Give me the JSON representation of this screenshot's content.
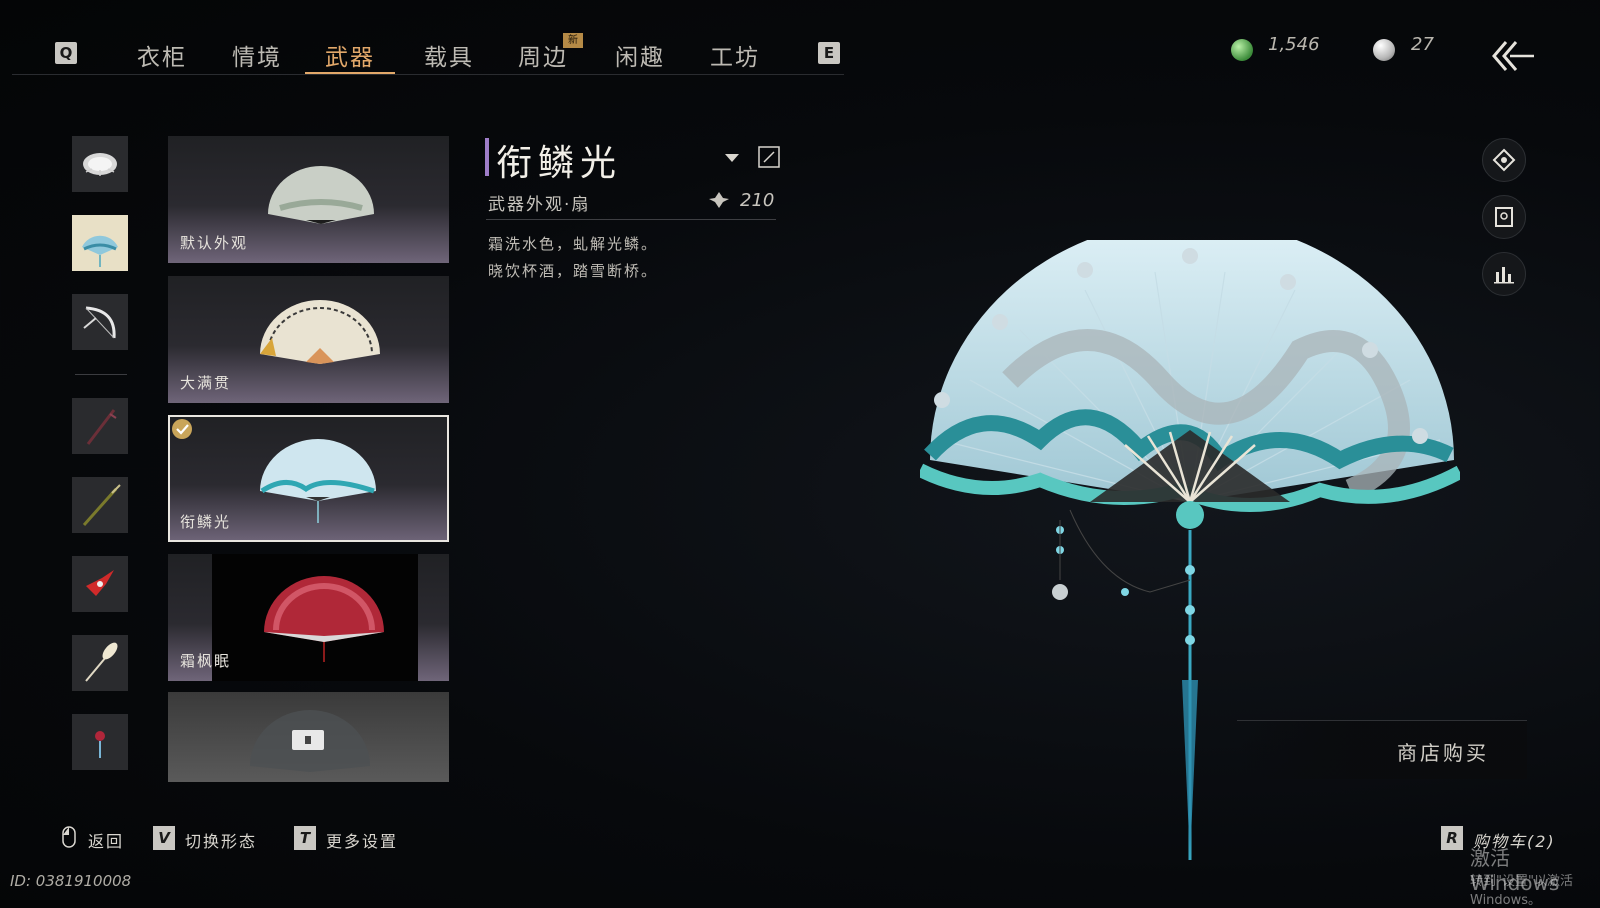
{
  "nav": {
    "prev_key": "Q",
    "next_key": "E",
    "tabs": [
      {
        "label": "衣柜"
      },
      {
        "label": "情境"
      },
      {
        "label": "武器",
        "active": true
      },
      {
        "label": "载具"
      },
      {
        "label": "周边",
        "badge": "新"
      },
      {
        "label": "闲趣"
      },
      {
        "label": "工坊"
      }
    ]
  },
  "currency": {
    "jade": {
      "icon": "jade-coin-icon",
      "value": "1,546"
    },
    "pearl": {
      "icon": "pearl-icon",
      "value": "27"
    }
  },
  "categories": [
    {
      "icon": "umbrella-icon"
    },
    {
      "icon": "fan-icon",
      "selected": true
    },
    {
      "icon": "bow-icon"
    },
    {
      "icon": "staff-icon"
    },
    {
      "icon": "spear-icon"
    },
    {
      "icon": "red-blade-icon"
    },
    {
      "icon": "brush-icon"
    },
    {
      "icon": "tassel-icon"
    }
  ],
  "items": [
    {
      "name": "默认外观"
    },
    {
      "name": "大满贯"
    },
    {
      "name": "衔鳞光",
      "selected": true,
      "owned": true
    },
    {
      "name": "霜枫眠"
    },
    {
      "name": "",
      "locked": true
    }
  ],
  "detail": {
    "title": "衔鳞光",
    "type": "武器外观·扇",
    "score": "210",
    "desc_line1": "霜洗水色，虬解光鳞。",
    "desc_line2": "晓饮杯酒，踏雪断桥。"
  },
  "side_buttons": [
    {
      "icon": "compass-icon"
    },
    {
      "icon": "frame-icon"
    },
    {
      "icon": "bar-chart-icon"
    }
  ],
  "shop_button": "商店购买",
  "footer": {
    "back_label": "返回",
    "switch_key": "V",
    "switch_label": "切换形态",
    "settings_key": "T",
    "settings_label": "更多设置",
    "cart_key": "R",
    "cart_label": "购物车(2)",
    "account_id": "ID: 0381910008"
  },
  "watermark": {
    "line1": "激活 Windows",
    "line2": "转到\"设置\"以激活 Windows。"
  },
  "colors": {
    "accent": "#e2a86a",
    "title_bar": "#9e7dc8"
  }
}
